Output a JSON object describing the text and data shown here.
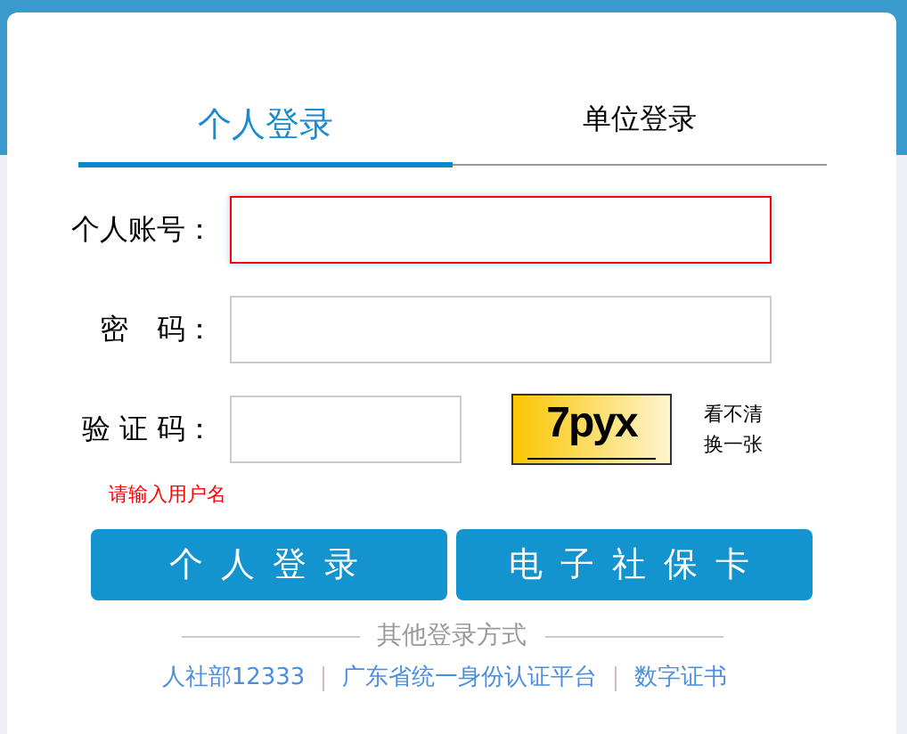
{
  "tabs": [
    {
      "label": "个人登录",
      "selected": true
    },
    {
      "label": "单位登录",
      "selected": false
    }
  ],
  "fields": [
    {
      "label": "个人账号：",
      "kind": "text",
      "error": true
    },
    {
      "label": "密　码：",
      "kind": "password",
      "error": false
    },
    {
      "label": "验 证 码：",
      "kind": "captcha",
      "error": false,
      "captcha_text": "7pyx",
      "refresh": [
        "看不清",
        "换一张"
      ]
    }
  ],
  "error_message": "请输入用户名",
  "buttons": [
    "个人登录",
    "电子社保卡"
  ],
  "other_title": "其他登录方式",
  "links": [
    "人社部12333",
    "广东省统一身份认证平台",
    "数字证书"
  ]
}
